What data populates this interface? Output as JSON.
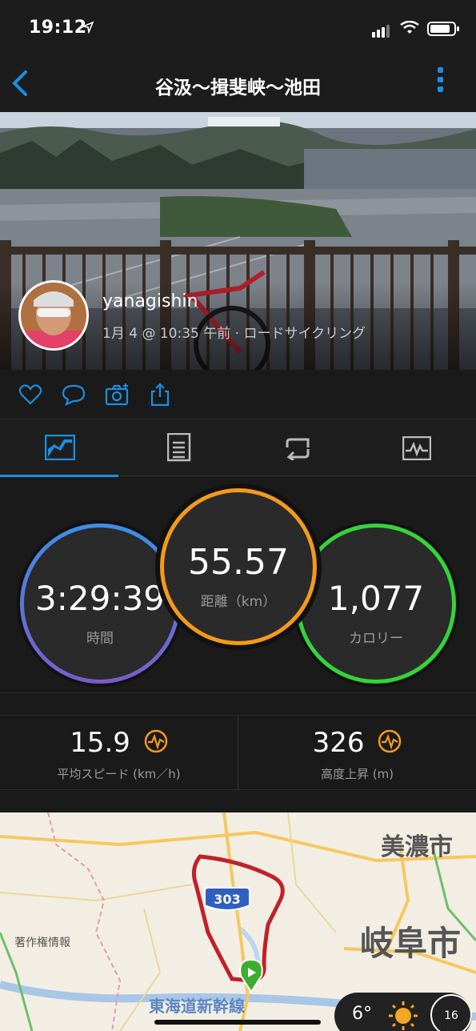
{
  "status_bar": {
    "time": "19:12"
  },
  "nav": {
    "title": "谷汲〜揖斐峡〜池田"
  },
  "activity": {
    "username": "yanagishin",
    "meta": "1月 4 @ 10:35 午前 · ロードサイクリング"
  },
  "circles": {
    "time": {
      "value": "3:29:39",
      "label": "時間"
    },
    "distance": {
      "value": "55.57",
      "label": "距離（km）"
    },
    "calories": {
      "value": "1,077",
      "label": "カロリー"
    }
  },
  "stats": {
    "avg_speed": {
      "value": "15.9",
      "label": "平均スピード (km／h)"
    },
    "elevation": {
      "value": "326",
      "label": "高度上昇 (m)"
    }
  },
  "map": {
    "route_badge": "303",
    "cities": [
      "美濃市",
      "岐阜市",
      "著作権情報",
      "東海道新幹線"
    ],
    "weather_temp": "6°",
    "wind_speed": "16"
  },
  "colors": {
    "accent": "#1a8fe3",
    "distance_ring": "#f39a1b",
    "calorie_ring": "#35d33a",
    "time_ring_top": "#3c8fe8",
    "time_ring_bottom": "#7a5cc8",
    "chart_icon": "#f39a1b",
    "route": "#c0212a"
  }
}
